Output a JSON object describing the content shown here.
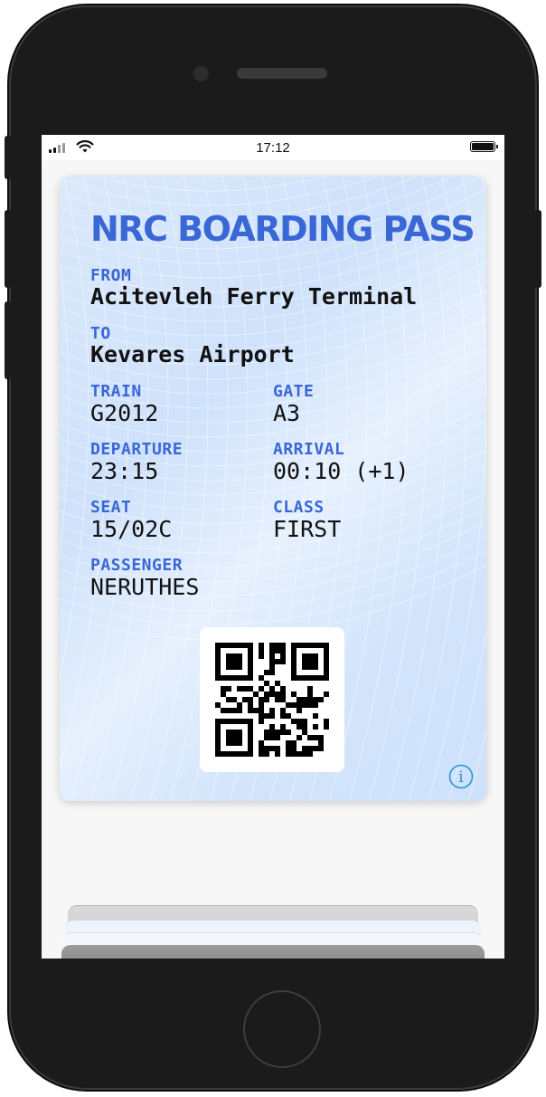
{
  "status_bar": {
    "time": "17:12",
    "icons": [
      "cellular-signal-icon",
      "wifi-icon",
      "battery-icon"
    ]
  },
  "pass": {
    "title": "NRC BOARDING PASS",
    "from_label": "FROM",
    "from_value": "Acitevleh Ferry Terminal",
    "to_label": "TO",
    "to_value": "Kevares Airport",
    "train_label": "TRAIN",
    "train_value": "G2012",
    "gate_label": "GATE",
    "gate_value": "A3",
    "departure_label": "DEPARTURE",
    "departure_value": "23:15",
    "arrival_label": "ARRIVAL",
    "arrival_value": "00:10 (+1)",
    "seat_label": "SEAT",
    "seat_value": "15/02C",
    "class_label": "CLASS",
    "class_value": "FIRST",
    "passenger_label": "PASSENGER",
    "passenger_value": "NERUTHES",
    "info_icon": "info-icon",
    "code": "qr-code"
  },
  "colors": {
    "accent": "#3a67d6",
    "pass_background": "#d6e7fc",
    "device_frame": "#1b1b1b"
  }
}
